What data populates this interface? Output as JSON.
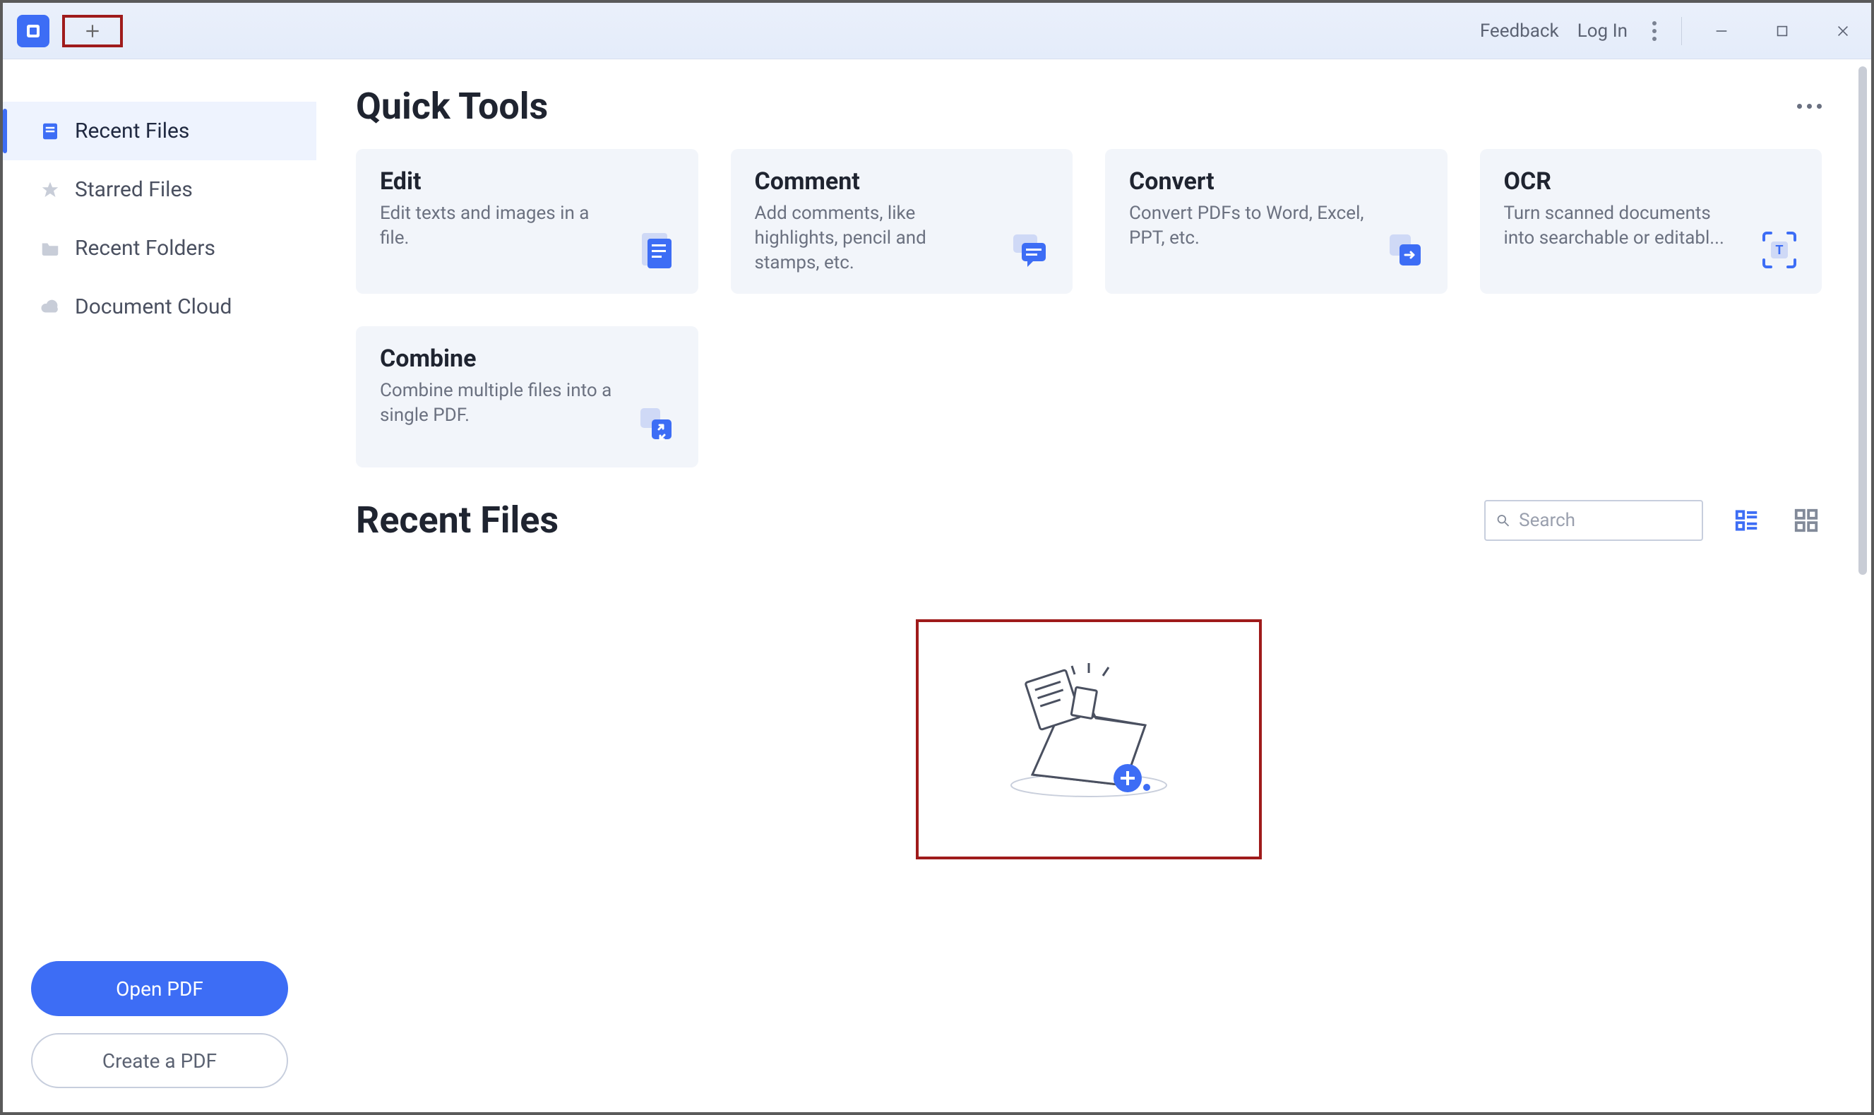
{
  "titlebar": {
    "feedback": "Feedback",
    "login": "Log In"
  },
  "sidebar": {
    "items": [
      {
        "label": "Recent Files"
      },
      {
        "label": "Starred Files"
      },
      {
        "label": "Recent Folders"
      },
      {
        "label": "Document Cloud"
      }
    ],
    "open_pdf": "Open PDF",
    "create_pdf": "Create a PDF"
  },
  "main": {
    "quick_tools_title": "Quick Tools",
    "tools": [
      {
        "title": "Edit",
        "desc": "Edit texts and images in a file."
      },
      {
        "title": "Comment",
        "desc": "Add comments, like highlights, pencil and stamps, etc."
      },
      {
        "title": "Convert",
        "desc": "Convert PDFs to Word, Excel, PPT, etc."
      },
      {
        "title": "OCR",
        "desc": "Turn scanned documents into searchable or editabl..."
      },
      {
        "title": "Combine",
        "desc": "Combine multiple files into a single PDF."
      }
    ],
    "recent_files_title": "Recent Files",
    "search_placeholder": "Search"
  }
}
